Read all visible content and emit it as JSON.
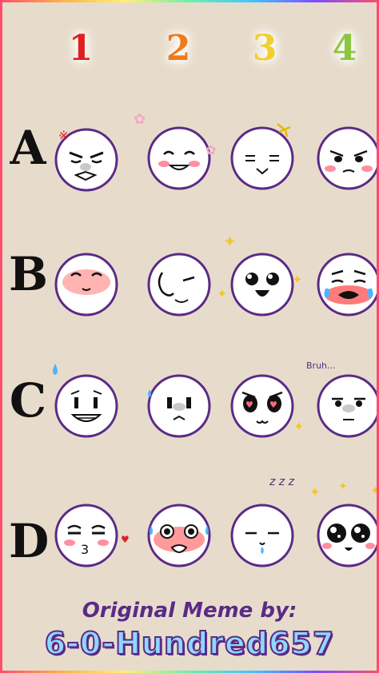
{
  "columns": [
    "1",
    "2",
    "3",
    "4"
  ],
  "column_colors": [
    "#e02020",
    "#f07a1a",
    "#f2cf2e",
    "#8cc63f"
  ],
  "rows": [
    "A",
    "B",
    "C",
    "D"
  ],
  "annotations": {
    "bruh": "Bruh...",
    "sleep": "z z z"
  },
  "credit": {
    "line1": "Original Meme by:",
    "line2": "6-0-Hundred657"
  },
  "colors": {
    "outline": "#5b2a86",
    "background": "#e7dccb",
    "blush": "#ff6b81",
    "tear": "#4fb3ff",
    "sparkle": "#f7c623"
  }
}
